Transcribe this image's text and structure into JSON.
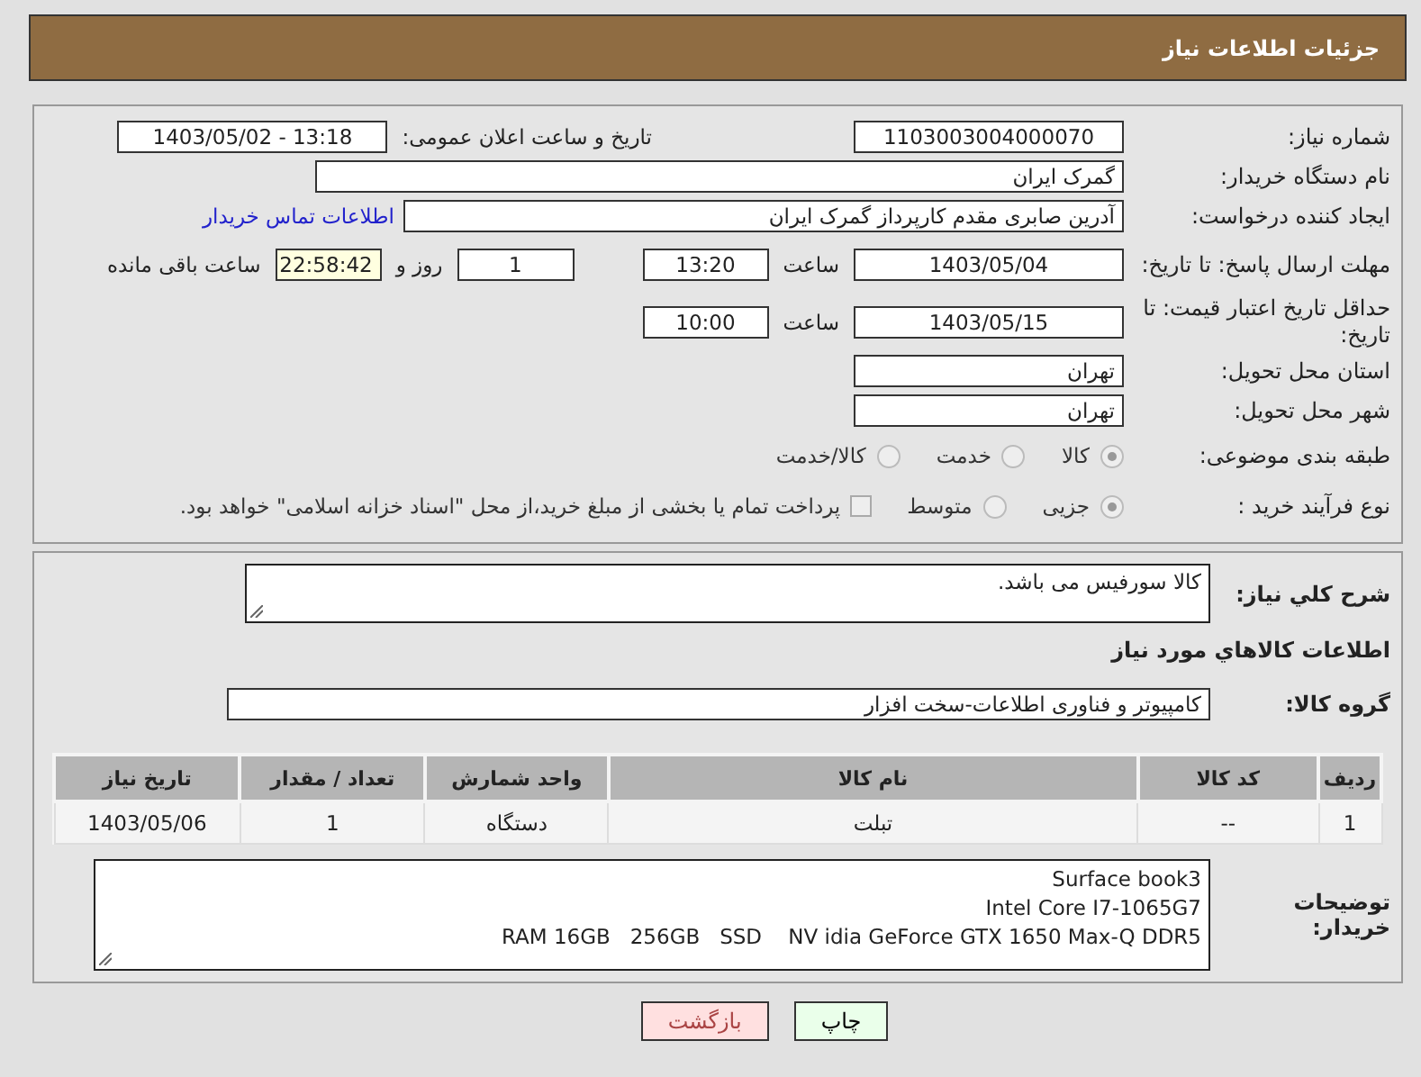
{
  "header": {
    "title": "جزئیات اطلاعات نیاز"
  },
  "need_number": {
    "label": "شماره نیاز:",
    "value": "1103003004000070"
  },
  "announce": {
    "label": "تاریخ و ساعت اعلان عمومی:",
    "value": "1403/05/02 - 13:18"
  },
  "buyer": {
    "label": "نام دستگاه خریدار:",
    "value": "گمرک ایران"
  },
  "requester": {
    "label": "ایجاد کننده درخواست:",
    "value": "آدرین صابری مقدم کارپرداز گمرک ایران",
    "link": "اطلاعات تماس خریدار"
  },
  "deadline": {
    "label": "مهلت ارسال پاسخ: تا تاریخ:",
    "date": "1403/05/04",
    "time_label": "ساعت",
    "time": "13:20",
    "days": "1",
    "days_label": "روز و",
    "remaining": "22:58:42",
    "remaining_label": "ساعت باقی مانده"
  },
  "validity": {
    "label": "حداقل تاریخ اعتبار قیمت: تا تاریخ:",
    "date": "1403/05/15",
    "time_label": "ساعت",
    "time": "10:00"
  },
  "province": {
    "label": "استان محل تحویل:",
    "value": "تهران"
  },
  "city": {
    "label": "شهر محل تحویل:",
    "value": "تهران"
  },
  "category": {
    "label": "طبقه بندی موضوعی:",
    "options": [
      {
        "label": "کالا",
        "selected": true
      },
      {
        "label": "خدمت",
        "selected": false
      },
      {
        "label": "کالا/خدمت",
        "selected": false
      }
    ]
  },
  "process": {
    "label": "نوع فرآیند خرید :",
    "options": [
      {
        "label": "جزیی",
        "selected": true
      },
      {
        "label": "متوسط",
        "selected": false
      }
    ],
    "payment": {
      "checked": false,
      "label": "پرداخت تمام یا بخشی از مبلغ خرید،از محل \"اسناد خزانه اسلامی\" خواهد بود."
    }
  },
  "description": {
    "label": "شرح کلي نیاز:",
    "value": "کالا سورفیس می باشد."
  },
  "goods_title": "اطلاعات کالاهاي مورد نیاز",
  "goods_group": {
    "label": "گروه کالا:",
    "value": "کامپیوتر و فناوری اطلاعات-سخت افزار"
  },
  "table": {
    "columns": [
      "ردیف",
      "کد کالا",
      "نام کالا",
      "واحد شمارش",
      "تعداد / مقدار",
      "تاریخ نیاز"
    ],
    "rows": [
      [
        "1",
        "--",
        "تبلت",
        "دستگاه",
        "1",
        "1403/05/06"
      ]
    ]
  },
  "notes": {
    "label": "توضیحات خریدار:",
    "lines": [
      "Surface book3",
      "Intel Core I7-1065G7",
      "RAM 16GB   256GB   SSD    NV idia GeForce GTX 1650 Max-Q DDR5"
    ]
  },
  "buttons": [
    {
      "label": "چاپ",
      "kind": "print"
    },
    {
      "label": "بازگشت",
      "kind": "back"
    }
  ]
}
